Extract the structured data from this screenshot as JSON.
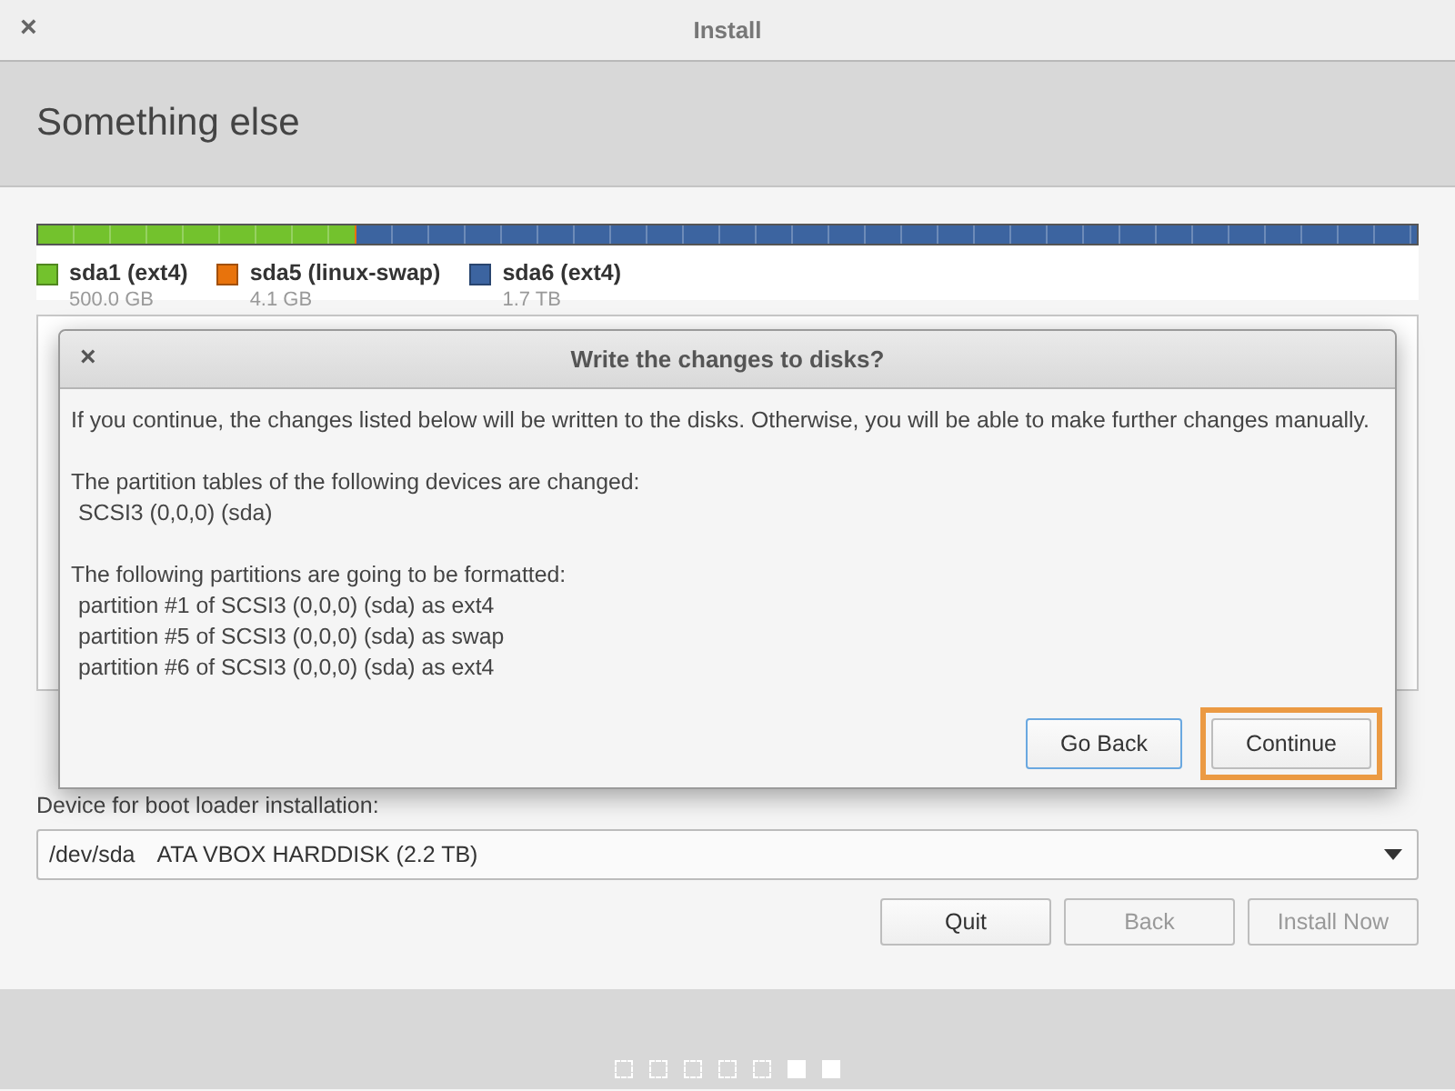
{
  "window": {
    "title": "Install",
    "close": "×"
  },
  "header": {
    "title": "Something else"
  },
  "partitions": [
    {
      "name": "sda1 (ext4)",
      "size": "500.0 GB",
      "color": "#73c22d",
      "level": 0.229
    },
    {
      "name": "sda5 (linux-swap)",
      "size": "4.1 GB",
      "color": "#e8730c",
      "level": 0.002
    },
    {
      "name": "sda6 (ext4)",
      "size": "1.7 TB",
      "color": "#3c64a0",
      "level": 0.769
    }
  ],
  "boot_loader": {
    "label": "Device for boot loader installation:",
    "device": "/dev/sda",
    "description": "ATA VBOX HARDDISK (2.2 TB)"
  },
  "buttons": [
    {
      "label": "Quit",
      "disabled": false
    },
    {
      "label": "Back",
      "disabled": true
    },
    {
      "label": "Install Now",
      "disabled": true
    }
  ],
  "pager": [
    {
      "filled": false
    },
    {
      "filled": false
    },
    {
      "filled": false
    },
    {
      "filled": false
    },
    {
      "filled": false
    },
    {
      "filled": true
    },
    {
      "filled": true
    }
  ],
  "dialog": {
    "title": "Write the changes to disks?",
    "close": "×",
    "intro": "If you continue, the changes listed below will be written to the disks. Otherwise, you will be able to make further changes manually.",
    "sections": [
      {
        "heading": "The partition tables of the following devices are changed:",
        "items": [
          "SCSI3 (0,0,0) (sda)"
        ]
      },
      {
        "heading": "The following partitions are going to be formatted:",
        "items": [
          "partition #1 of SCSI3 (0,0,0) (sda) as ext4",
          "partition #5 of SCSI3 (0,0,0) (sda) as swap",
          "partition #6 of SCSI3 (0,0,0) (sda) as ext4"
        ]
      }
    ],
    "buttons": [
      {
        "label": "Go Back",
        "focused": true,
        "highlighted": false
      },
      {
        "label": "Continue",
        "focused": false,
        "highlighted": true
      }
    ]
  }
}
